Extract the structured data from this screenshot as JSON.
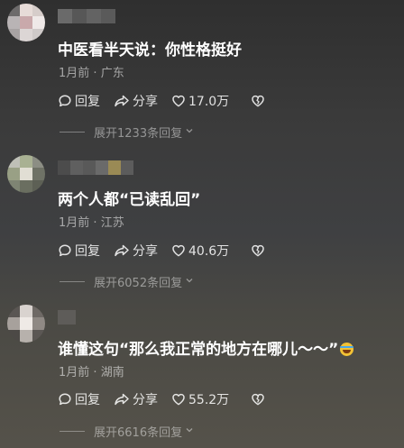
{
  "comments": [
    {
      "text": "中医看半天说：你性格挺好",
      "time": "1月前",
      "location": "广东",
      "reply_label": "回复",
      "share_label": "分享",
      "likes": "17.0万",
      "expand_label": "展开1233条回复"
    },
    {
      "text": "两个人都“已读乱回”",
      "time": "1月前",
      "location": "江苏",
      "reply_label": "回复",
      "share_label": "分享",
      "likes": "40.6万",
      "expand_label": "展开6052条回复"
    },
    {
      "text": "谁懂这句“那么我正常的地方在哪儿～～”",
      "time": "1月前",
      "location": "湖南",
      "reply_label": "回复",
      "share_label": "分享",
      "likes": "55.2万",
      "expand_label": "展开6616条回复"
    }
  ],
  "meta_separator": " · ",
  "icons": {
    "reply": "comment-bubble-icon",
    "share": "share-arrow-icon",
    "like": "heart-icon",
    "dislike": "broken-heart-icon",
    "expand": "chevron-down-icon",
    "emoji": "laughing-crying-emoji-icon"
  }
}
